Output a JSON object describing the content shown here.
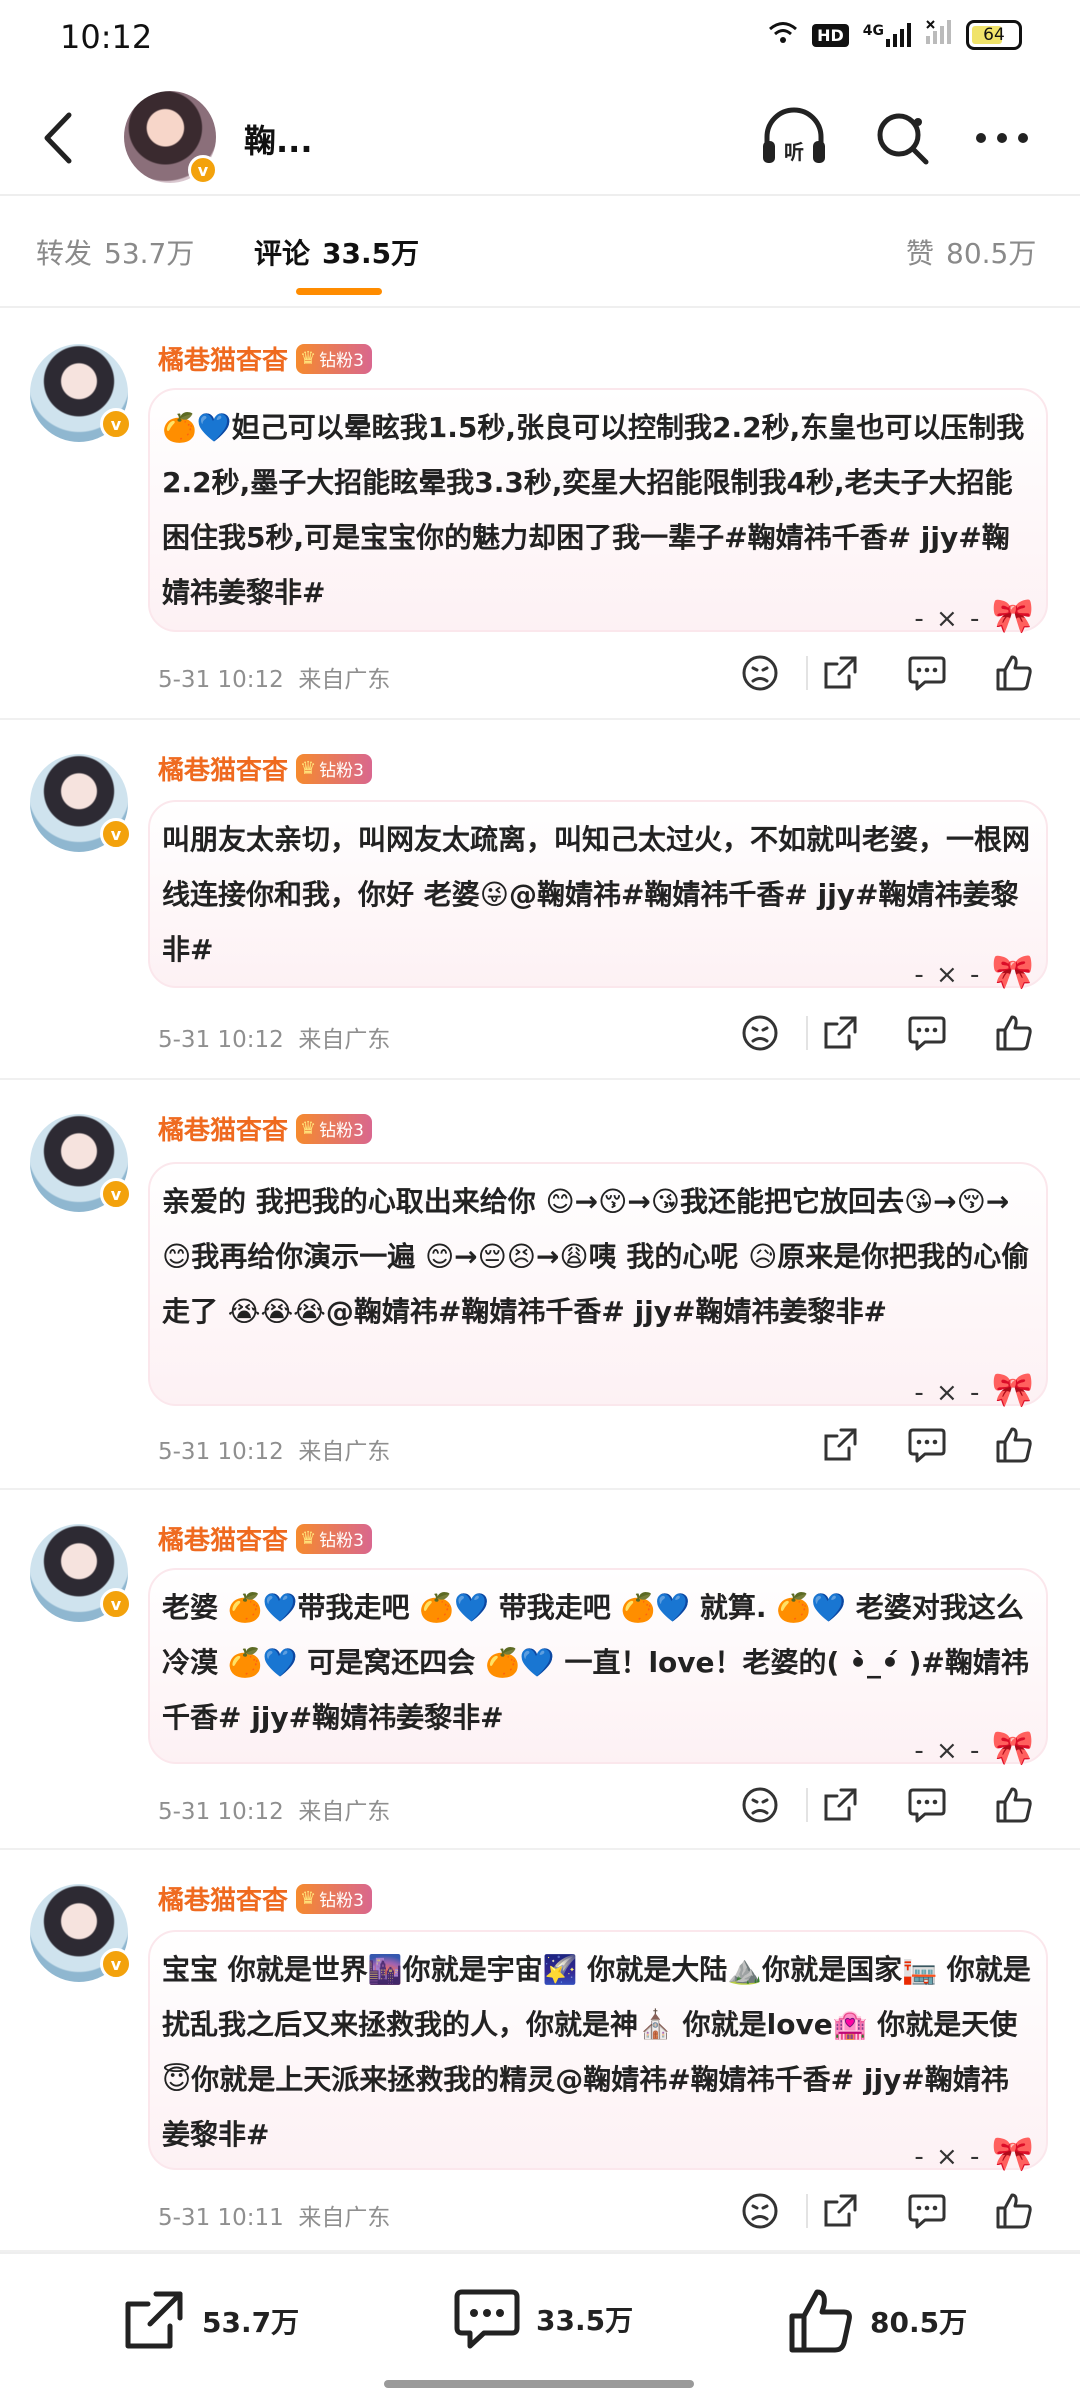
{
  "status_bar": {
    "time": "10:12",
    "network_badge": "HD",
    "network_type": "4G",
    "battery_level": "64"
  },
  "header": {
    "name": "鞠..."
  },
  "tabs": [
    {
      "label": "转发",
      "count": "53.7万"
    },
    {
      "label": "评论",
      "count": "33.5万"
    },
    {
      "label": "赞",
      "count": "80.5万"
    }
  ],
  "active_tab": "评论",
  "badge_label": "钻粉3",
  "comments": [
    {
      "author": "橘巷猫杳杳",
      "text": "🍊💙妲己可以晕眩我1.5秒,张良可以控制我2.2秒,东皇也可以压制我2.2秒,墨子大招能眩晕我3.3秒,奕星大招能限制我4秒,老夫子大招能困住我5秒,可是宝宝你的魅力却困了我一辈子#鞠婧祎千香# jjy#鞠婧祎姜黎非#",
      "time": "5-31  10:12",
      "source": "来自广东"
    },
    {
      "author": "橘巷猫杳杳",
      "text": "叫朋友太亲切，叫网友太疏离，叫知己太过火，不如就叫老婆，一根网线连接你和我，你好 老婆😜@鞠婧祎#鞠婧祎千香# jjy#鞠婧祎姜黎非#",
      "time": "5-31  10:12",
      "source": "来自广东"
    },
    {
      "author": "橘巷猫杳杳",
      "text": "亲爱的 我把我的心取出来给你 😊→😚→😘我还能把它放回去😘→😚→😊我再给你演示一遍 😊→😔😣→😩咦 我的心呢 😥原来是你把我的心偷走了 😭😭😭@鞠婧祎#鞠婧祎千香# jjy#鞠婧祎姜黎非#",
      "time": "5-31  10:12",
      "source": "来自广东"
    },
    {
      "author": "橘巷猫杳杳",
      "text": "老婆 🍊💙带我走吧 🍊💙 带我走吧 🍊💙 就算. 🍊💙 老婆对我这么冷漠 🍊💙 可是窝还四会 🍊💙 一直！love！老婆的( •̀_•́ )#鞠婧祎千香# jjy#鞠婧祎姜黎非#",
      "time": "5-31  10:12",
      "source": "来自广东"
    },
    {
      "author": "橘巷猫杳杳",
      "text": "宝宝 你就是世界🌆你就是宇宙🌠 你就是大陆⛰️你就是国家🏣 你就是扰乱我之后又来拯救我的人，你就是神⛪ 你就是love🏩 你就是天使😇你就是上天派来拯救我的精灵@鞠婧祎#鞠婧祎千香# jjy#鞠婧祎姜黎非#",
      "time": "5-31  10:11",
      "source": "来自广东"
    }
  ],
  "bottom_bar": {
    "repost_count": "53.7万",
    "comment_count": "33.5万",
    "like_count": "80.5万"
  },
  "colors": {
    "accent": "#ff8c00",
    "author_name": "#ef6a1f",
    "bubble_bg": "#fdf1f4",
    "meta_text": "#8f8f8f"
  },
  "icons": [
    "back-arrow-icon",
    "headphones-listen-icon",
    "search-icon",
    "more-icon",
    "bow-icon",
    "dislike-icon",
    "share-icon",
    "comment-icon",
    "like-icon",
    "verified-icon",
    "crown-icon"
  ]
}
